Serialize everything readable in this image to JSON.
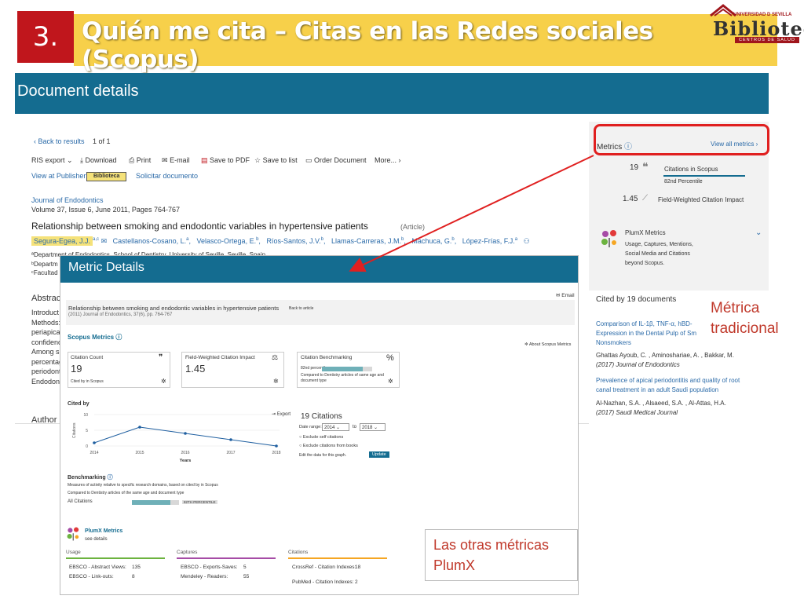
{
  "slide": {
    "number": "3.",
    "title": "Quién me cita – Citas en las Redes sociales (Scopus)",
    "colors": {
      "number_bg": "#c0161c",
      "title_bar": "#f7d04a",
      "scopus_header": "#146c90",
      "callout_text": "#c0392b",
      "arrow": "#e02020"
    }
  },
  "logo": {
    "university": "UNIVERSIDAD D SEVILLA",
    "name": "Biblioteca",
    "sub": "CENTROS DE SALUD"
  },
  "doc": {
    "header_title": "Document details",
    "back": "Back to results",
    "pager": "1  of  1",
    "toolbar": [
      "RIS export",
      "Download",
      "Print",
      "E-mail",
      "Save to PDF",
      "Save to list",
      "Order Document",
      "More..."
    ],
    "view_publisher": "View at Publisher",
    "biblioteca_btn": "Biblioteca",
    "solicitar": "Solicitar documento",
    "journal": "Journal of Endodontics",
    "volume": "Volume 37, Issue 6, June 2011, Pages 764-767",
    "article_title": "Relationship between smoking and endodontic variables in hypertensive patients",
    "article_type": "(Article)",
    "authors": [
      "Segura-Egea, J.J.",
      "Castellanos-Cosano, L.",
      "Velasco-Ortega, E.",
      "Ríos-Santos, J.V.",
      "Llamas-Carreras, J.M.",
      "Machuca, G.",
      "López-Frías, F.J."
    ],
    "affil_a": "ªDepartment of Endodontics, School of Dentistry, University of Seville, Seville, Spain",
    "affil_b": "ᵇDepartm",
    "affil_c": "ᶜFacultad",
    "abstract_label": "Abstrac",
    "abstract_lines": [
      "Introduct",
      "Methods:",
      "periapical",
      "confidenc",
      "Among si",
      "percentag",
      "periodont",
      "Endodont"
    ],
    "author_label": "Author"
  },
  "metrics_side": {
    "label": "Metrics",
    "view_all": "View all metrics",
    "citations_value": "19",
    "citations_label": "Citations in Scopus",
    "percentile": "82nd Percentile",
    "fwci_value": "1.45",
    "fwci_label": "Field-Weighted Citation Impact",
    "plumx_label": "PlumX Metrics",
    "plumx_desc": [
      "Usage, Captures, Mentions,",
      "Social Media and Citations",
      "beyond Scopus."
    ],
    "cited_by": "Cited by 19 documents",
    "refs": [
      {
        "title": [
          "Comparison of IL-1β, TNF-α, hBD-",
          "Expression in the Dental Pulp of Sm",
          "Nonsmokers"
        ],
        "authors": "Ghattas Ayoub, C. , Aminoshariae, A. , Bakkar, M.",
        "source": "(2017) Journal of Endodontics"
      },
      {
        "title": [
          "Prevalence of apical periodontitis and quality of root",
          "canal treatment in an adult Saudi population"
        ],
        "authors": "Al-Nazhan, S.A. , Alsaeed, S.A. , Al-Attas, H.A.",
        "source": "(2017) Saudi Medical Journal"
      }
    ]
  },
  "metric_details": {
    "title": "Metric Details",
    "email": "Email",
    "article": "Relationship between smoking and endodontic variables in hypertensive patients",
    "back_to_article": "Back to article",
    "source_line": "(2011) Journal of Endodontics, 37(6), pp. 764-767",
    "scopus_metrics": "Scopus Metrics",
    "about": "About Scopus Metrics",
    "card1": {
      "label": "Citation Count",
      "value": "19",
      "foot": "Cited by in Scopus"
    },
    "card2": {
      "label": "Field-Weighted Citation Impact",
      "value": "1.45"
    },
    "card3": {
      "label": "Citation Benchmarking",
      "pct": "82nd percentile",
      "desc": [
        "Compared to Dentistry articles of same age and",
        "document type"
      ],
      "fill": 0.82
    },
    "cited_by": "Cited by",
    "export": "Export",
    "citations_count": "19  Citations",
    "date_range_label": "Date range:",
    "date_from": "2014",
    "date_to_label": "to",
    "date_to": "2018",
    "exclude_self": "Exclude self citations",
    "exclude_books": "Exclude citations from books",
    "edit_data": "Edit the data for this graph.",
    "update": "Update",
    "benchmarking": "Benchmarking",
    "bench_desc1": "Measures of activity relative to specific research domains, based on cited by in Scopus",
    "bench_desc2": "Compared to Dentistry articles of the same age and document type",
    "all_citations": "All Citations",
    "all_citations_pct": "82TH PERCENTILE",
    "all_citations_fill": 0.82,
    "plumx": "PlumX Metrics",
    "see_details": "see details",
    "usage": "Usage",
    "captures": "Captures",
    "citations_h": "Citations",
    "usage_rows": [
      {
        "label": "EBSCO - Abstract Views:",
        "value": "135"
      },
      {
        "label": "EBSCO - Link-outs:",
        "value": "8"
      }
    ],
    "capture_rows": [
      {
        "label": "EBSCO - Exports-Saves:",
        "value": "5"
      },
      {
        "label": "Mendeley - Readers:",
        "value": "55"
      }
    ],
    "citation_rows": [
      {
        "label": "CrossRef - Citation Indexes:",
        "value": "18"
      },
      {
        "label": "PubMed - Citation Indexes:",
        "value": "2"
      }
    ]
  },
  "chart_data": {
    "type": "line",
    "title": "",
    "x": [
      "2014",
      "2015",
      "2016",
      "2017",
      "2018"
    ],
    "series": [
      {
        "values": [
          1,
          6,
          4,
          2,
          0
        ]
      }
    ],
    "xlabel": "Years",
    "ylabel": "Citations",
    "yticks": [
      "0",
      "5",
      "10"
    ],
    "ylim": [
      0,
      10
    ]
  },
  "callouts": {
    "metrica": [
      "Métrica",
      "tradicional"
    ],
    "plumx": [
      "Las otras métricas",
      "PlumX"
    ]
  }
}
